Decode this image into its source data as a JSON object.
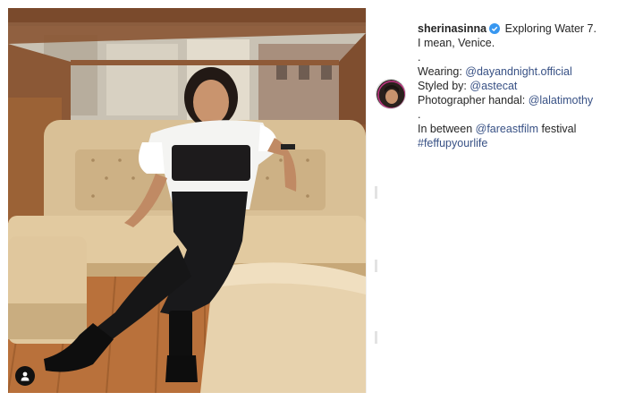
{
  "post": {
    "username": "sherinasinna",
    "verified": true,
    "caption_lines": [
      {
        "text": "Exploring Water 7."
      },
      {
        "text": "I mean, Venice."
      },
      {
        "text": "."
      },
      {
        "prefix": "Wearing: ",
        "link": "@dayandnight.official"
      },
      {
        "prefix": "Styled by: ",
        "link": "@astecat"
      },
      {
        "prefix": "Photographer handal: ",
        "link": "@lalatimothy"
      },
      {
        "text": "."
      },
      {
        "prefix": "In between ",
        "link": "@fareastfilm",
        "suffix": " festival"
      },
      {
        "link": "#feffupyourlife"
      }
    ]
  },
  "colors": {
    "link": "#385185",
    "text": "#262626",
    "verified": "#3897f0"
  },
  "icons": {
    "user_tag": "person-icon",
    "verified": "verified-badge-icon"
  }
}
